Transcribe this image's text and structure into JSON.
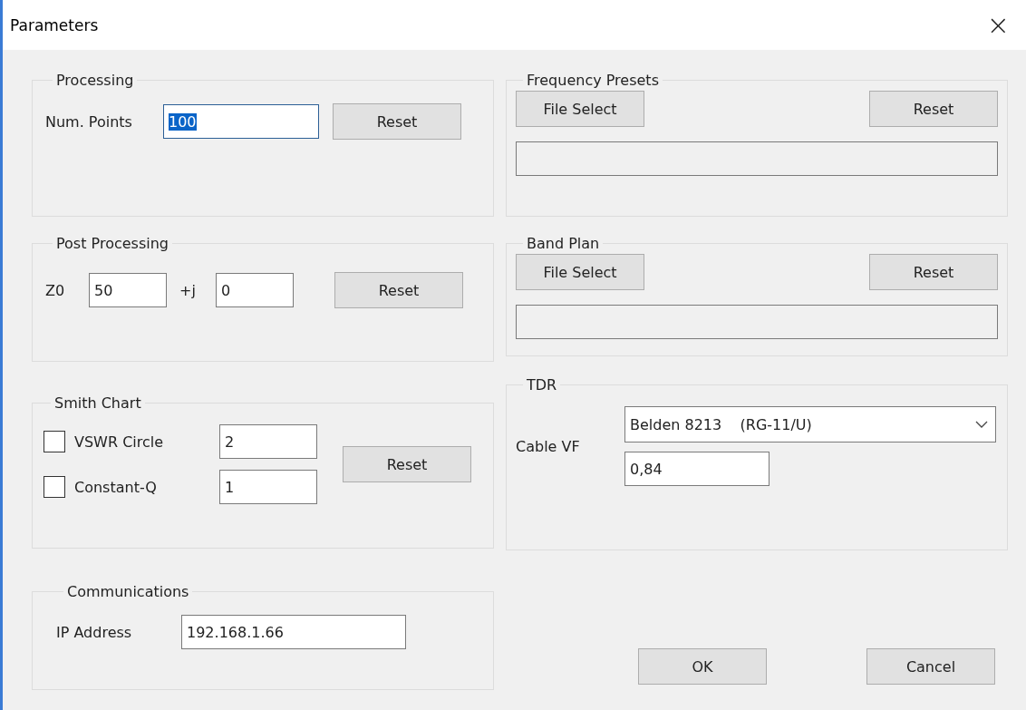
{
  "window": {
    "title": "Parameters",
    "close": "×"
  },
  "processing": {
    "title": "Processing",
    "label": "Num. Points",
    "value": "100",
    "text_selected": true,
    "button": "Reset"
  },
  "post_processing": {
    "title": "Post Processing",
    "z_label": "Z0",
    "z_value": "50",
    "j_label": "+j",
    "j_value": "0",
    "button": "Reset"
  },
  "smith_chart": {
    "title": "Smith Chart",
    "options": [
      {
        "label": "VSWR Circle",
        "checked": false,
        "value": "2"
      },
      {
        "label": "Constant-Q",
        "checked": false,
        "value": "1"
      }
    ],
    "button": "Reset"
  },
  "communications": {
    "title": "Communications",
    "label": "IP Address",
    "value": "192.168.1.66"
  },
  "frequency_presets": {
    "title": "Frequency Presets",
    "select_button": "File Select",
    "reset_button": "Reset"
  },
  "band_plan": {
    "title": "Band Plan",
    "select_button": "File Select",
    "reset_button": "Reset"
  },
  "tdr": {
    "title": "TDR",
    "label": "Cable VF",
    "cable": "Belden 8213    (RG-11/U)",
    "value": "0,84"
  },
  "buttons": [
    "OK",
    "Cancel"
  ]
}
